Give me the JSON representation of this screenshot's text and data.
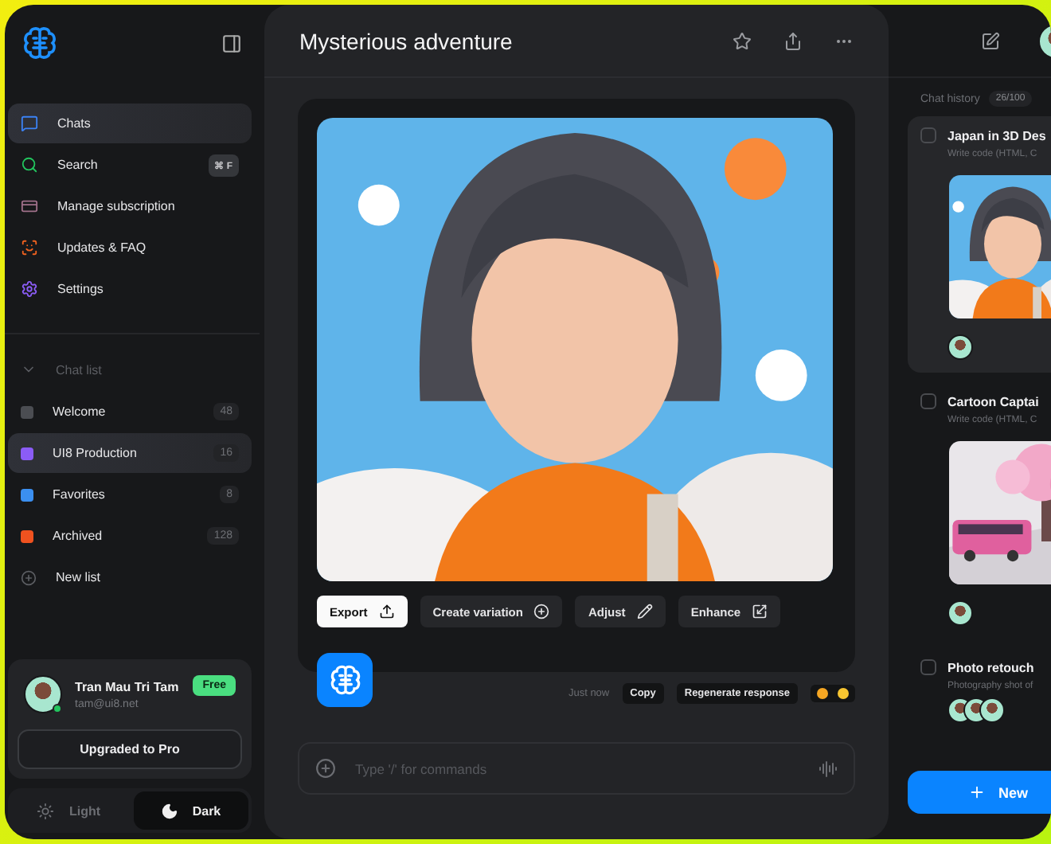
{
  "sidebar": {
    "nav": [
      {
        "kind": "chats",
        "label": "Chats",
        "selected": true,
        "color": "#3b82f6"
      },
      {
        "kind": "search",
        "label": "Search",
        "selected": false,
        "shortcut": "⌘ F",
        "color": "#22c55e"
      },
      {
        "kind": "subscription",
        "label": "Manage subscription",
        "selected": false,
        "color": "#a0708a"
      },
      {
        "kind": "updates",
        "label": "Updates & FAQ",
        "selected": false,
        "color": "#f0621f"
      },
      {
        "kind": "settings",
        "label": "Settings",
        "selected": false,
        "color": "#8b5cf6"
      }
    ],
    "chat_list": {
      "title": "Chat list",
      "expanded": true,
      "items": [
        {
          "label": "Welcome",
          "count": "48",
          "color": "#4b4d52",
          "selected": false
        },
        {
          "label": "UI8 Production",
          "count": "16",
          "color": "#8b5cf6",
          "selected": true
        },
        {
          "label": "Favorites",
          "count": "8",
          "color": "#3b8ff0",
          "selected": false
        },
        {
          "label": "Archived",
          "count": "128",
          "color": "#f0521f",
          "selected": false
        }
      ],
      "new_list": "New list"
    },
    "user": {
      "name": "Tran Mau Tri Tam",
      "email": "tam@ui8.net",
      "plan": "Free",
      "online": true
    },
    "upgrade_button": "Upgraded to Pro",
    "theme": [
      {
        "kind": "light",
        "label": "Light",
        "selected": false
      },
      {
        "kind": "dark",
        "label": "Dark",
        "selected": true
      }
    ]
  },
  "main": {
    "title": "Mysterious adventure",
    "image_actions": [
      {
        "label": "Export",
        "kind": "primary"
      },
      {
        "label": "Create variation",
        "kind": "secondary"
      },
      {
        "label": "Adjust",
        "kind": "secondary"
      },
      {
        "label": "Enhance",
        "kind": "secondary"
      }
    ],
    "time": "Just now",
    "message_actions": [
      "Copy",
      "Regenerate response"
    ],
    "composer": {
      "placeholder": "Type '/' for commands"
    }
  },
  "history": {
    "title": "Chat history",
    "count": "26/100",
    "chats": [
      {
        "title": "Japan in 3D Des",
        "subtitle": "Write code (HTML, C",
        "checked": false,
        "selected": true,
        "kind": "girl"
      },
      {
        "title": "Cartoon Captai",
        "subtitle": "Write code (HTML, C",
        "checked": false,
        "selected": false,
        "kind": "bus"
      },
      {
        "title": "Photo retouch",
        "subtitle": "Photography shot of",
        "checked": false,
        "selected": false,
        "kind": "group"
      }
    ],
    "new_button": "New"
  }
}
